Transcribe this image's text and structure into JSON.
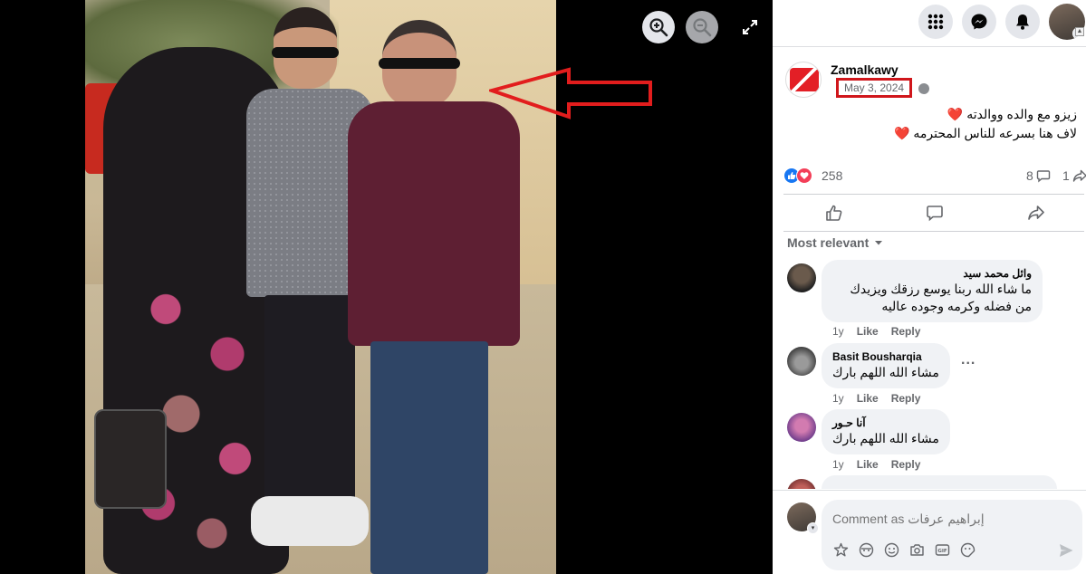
{
  "post": {
    "page_name": "Zamalkawy",
    "date": "May 3, 2024",
    "privacy_icon": "globe-icon",
    "text_line1": "زيزو مع والده ووالدته",
    "text_line2": "لاف هنا بسرعه للناس المحترمه",
    "heart": "❤️",
    "reaction_count": "258",
    "comment_count": "8",
    "share_count": "1"
  },
  "sort": {
    "label": "Most relevant"
  },
  "comments": [
    {
      "name": "وائل محمد سيد",
      "text": "ما شاء الله ربنا يوسع رزقك ويزيدك من فضله وكرمه وجوده عاليه",
      "age": "1y",
      "like": "Like",
      "reply": "Reply"
    },
    {
      "name": "Basit Bousharqia",
      "text": "مشاء الله اللهم بارك",
      "age": "1y",
      "like": "Like",
      "reply": "Reply",
      "more": "..."
    },
    {
      "name": "آنا حـور",
      "text": "مشاء الله اللهم بارك",
      "age": "1y",
      "like": "Like",
      "reply": "Reply"
    }
  ],
  "composer": {
    "placeholder": "Comment as إبراهيم عرفات"
  },
  "colors": {
    "facebook_blue": "#1877f2",
    "love_red": "#f33e58",
    "highlight_red": "#d0161b"
  },
  "icons": [
    "zoom-in-icon",
    "zoom-out-icon",
    "fullscreen-icon",
    "menu-grid-icon",
    "messenger-icon",
    "bell-icon",
    "like-icon",
    "comment-icon",
    "share-icon",
    "sticker-icon",
    "avatar-emoji-icon",
    "emoji-icon",
    "camera-icon",
    "gif-icon",
    "sticker-face-icon",
    "send-icon"
  ]
}
